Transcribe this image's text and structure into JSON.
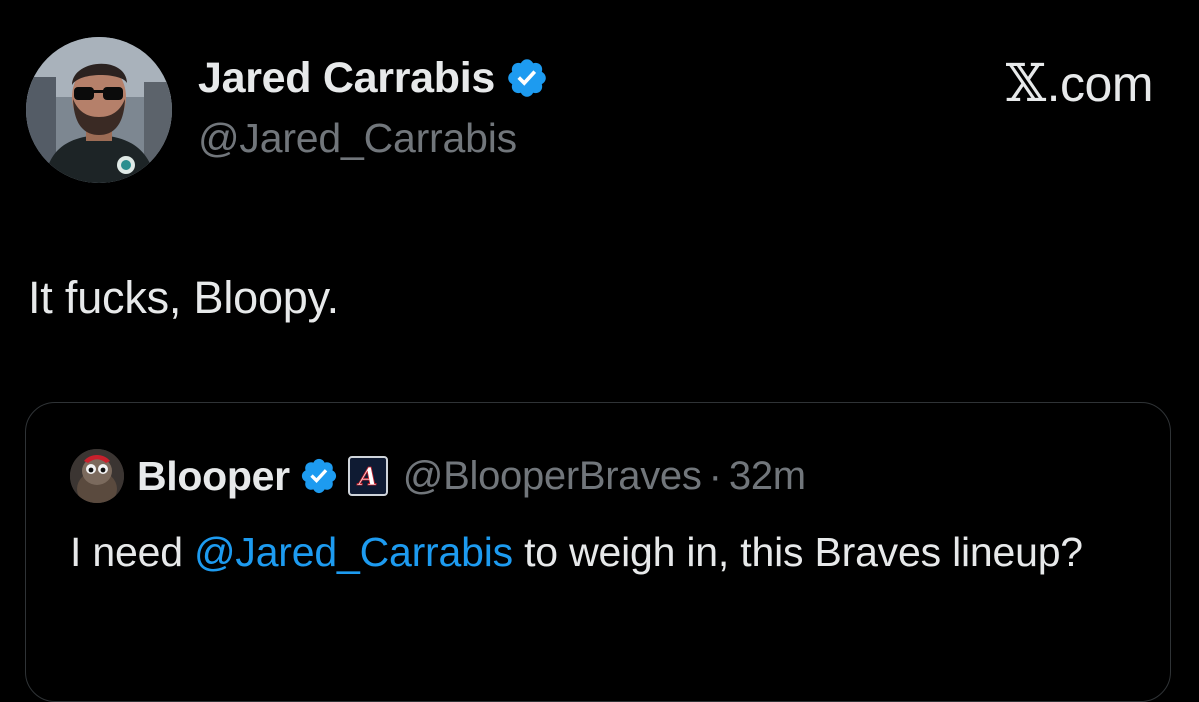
{
  "author": {
    "name": "Jared Carrabis",
    "handle": "@Jared_Carrabis",
    "avatar_icon": "profile-photo-icon",
    "verified_icon": "verified-badge-icon"
  },
  "brand": {
    "x_glyph": "𝕏",
    "domain": ".com"
  },
  "tweet": {
    "text": "It fucks, Bloopy."
  },
  "quote": {
    "name": "Blooper",
    "handle": "@BlooperBraves",
    "separator": "·",
    "time": "32m",
    "affiliate_letter": "A",
    "body_prefix": "I need ",
    "mention": "@Jared_Carrabis",
    "body_suffix": " to weigh in, this Braves lineup?"
  },
  "colors": {
    "background": "#000000",
    "text_primary": "#e7e9ea",
    "text_secondary": "#71767b",
    "link": "#1d9bf0",
    "verified": "#1d9bf0",
    "card_border": "#2f3336"
  }
}
